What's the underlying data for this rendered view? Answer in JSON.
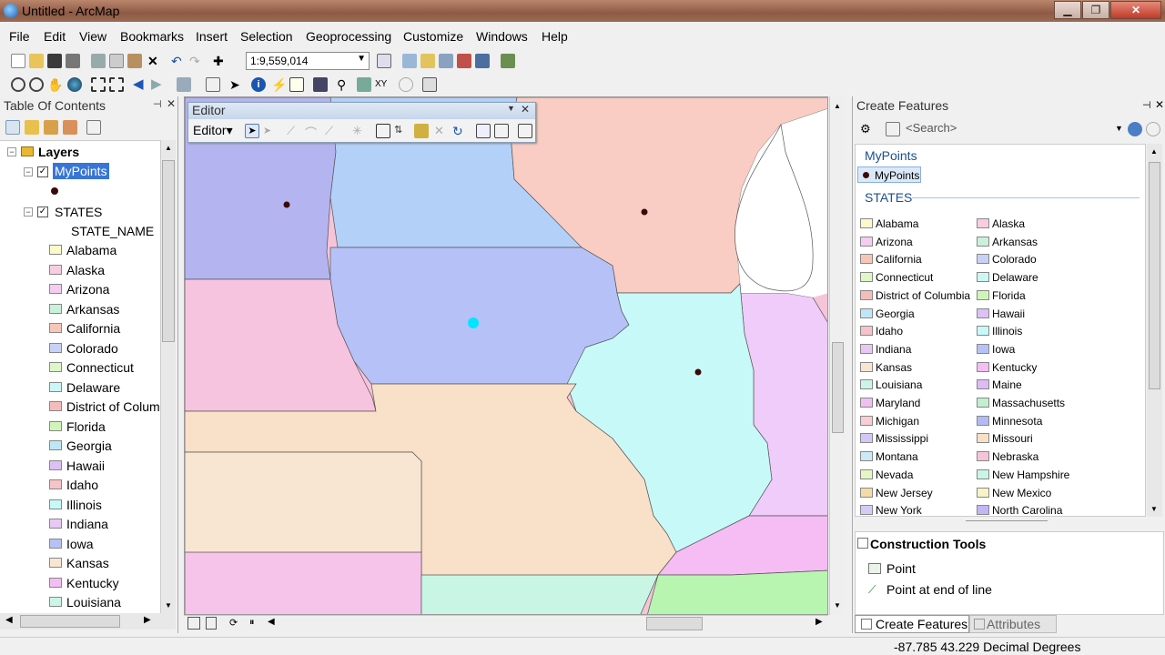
{
  "window": {
    "title": "Untitled - ArcMap",
    "minimize": "▁",
    "maximize": "❐",
    "close": "✕"
  },
  "menu": [
    "File",
    "Edit",
    "View",
    "Bookmarks",
    "Insert",
    "Selection",
    "Geoprocessing",
    "Customize",
    "Windows",
    "Help"
  ],
  "toolbar": {
    "scale": "1:9,559,014"
  },
  "toc": {
    "title": "Table Of Contents",
    "layers_label": "Layers",
    "mypoints": "MyPoints",
    "states": "STATES",
    "field": "STATE_NAME",
    "items": [
      {
        "name": "Alabama",
        "color": "#fbfacb"
      },
      {
        "name": "Alaska",
        "color": "#f8cde0"
      },
      {
        "name": "Arizona",
        "color": "#f6cdf0"
      },
      {
        "name": "Arkansas",
        "color": "#c9f1da"
      },
      {
        "name": "California",
        "color": "#f8c6b8"
      },
      {
        "name": "Colorado",
        "color": "#c8d2f6"
      },
      {
        "name": "Connecticut",
        "color": "#ddf7c8"
      },
      {
        "name": "Delaware",
        "color": "#cdf6f6"
      },
      {
        "name": "District of Colum",
        "color": "#f5bcbc"
      },
      {
        "name": "Florida",
        "color": "#d0f5b8"
      },
      {
        "name": "Georgia",
        "color": "#bde7f7"
      },
      {
        "name": "Hawaii",
        "color": "#dcc0f6"
      },
      {
        "name": "Idaho",
        "color": "#f6c3c8"
      },
      {
        "name": "Illinois",
        "color": "#c8f9f9"
      },
      {
        "name": "Indiana",
        "color": "#e8c8f4"
      },
      {
        "name": "Iowa",
        "color": "#b6c2f7"
      },
      {
        "name": "Kansas",
        "color": "#f9e6d2"
      },
      {
        "name": "Kentucky",
        "color": "#f5bdf3"
      },
      {
        "name": "Louisiana",
        "color": "#cbf5e6"
      }
    ]
  },
  "editor": {
    "title": "Editor",
    "menu": "Editor▾"
  },
  "create_features": {
    "title": "Create Features",
    "search_placeholder": "<Search>",
    "group_mypoints": "MyPoints",
    "mypoints_item": "MyPoints",
    "group_states": "STATES",
    "templates_left": [
      {
        "name": "Alabama",
        "color": "#fbfacb"
      },
      {
        "name": "Arizona",
        "color": "#f6cdf0"
      },
      {
        "name": "California",
        "color": "#f8c6b8"
      },
      {
        "name": "Connecticut",
        "color": "#ddf7c8"
      },
      {
        "name": "District of Columbia",
        "color": "#f5bcbc"
      },
      {
        "name": "Georgia",
        "color": "#bde7f7"
      },
      {
        "name": "Idaho",
        "color": "#f6c3c8"
      },
      {
        "name": "Indiana",
        "color": "#e8c8f4"
      },
      {
        "name": "Kansas",
        "color": "#f9e6d2"
      },
      {
        "name": "Louisiana",
        "color": "#cbf5e6"
      },
      {
        "name": "Maryland",
        "color": "#efc0f2"
      },
      {
        "name": "Michigan",
        "color": "#f8cdd4"
      },
      {
        "name": "Mississippi",
        "color": "#d4c6f6"
      },
      {
        "name": "Montana",
        "color": "#cbe9f7"
      },
      {
        "name": "Nevada",
        "color": "#e6f7c6"
      },
      {
        "name": "New Jersey",
        "color": "#f4dca8"
      },
      {
        "name": "New York",
        "color": "#d6cbf6"
      }
    ],
    "templates_right": [
      {
        "name": "Alaska",
        "color": "#f8cde0"
      },
      {
        "name": "Arkansas",
        "color": "#c9f1da"
      },
      {
        "name": "Colorado",
        "color": "#c8d2f6"
      },
      {
        "name": "Delaware",
        "color": "#cdf6f6"
      },
      {
        "name": "Florida",
        "color": "#d0f5b8"
      },
      {
        "name": "Hawaii",
        "color": "#dcc0f6"
      },
      {
        "name": "Illinois",
        "color": "#c8f9f9"
      },
      {
        "name": "Iowa",
        "color": "#b6c2f7"
      },
      {
        "name": "Kentucky",
        "color": "#f5bdf3"
      },
      {
        "name": "Maine",
        "color": "#dcbcf4"
      },
      {
        "name": "Massachusetts",
        "color": "#c2efd0"
      },
      {
        "name": "Minnesota",
        "color": "#b2bbf4"
      },
      {
        "name": "Missouri",
        "color": "#f8e0c6"
      },
      {
        "name": "Nebraska",
        "color": "#f6c4d8"
      },
      {
        "name": "New Hampshire",
        "color": "#c9f6e4"
      },
      {
        "name": "New Mexico",
        "color": "#f8f3c6"
      },
      {
        "name": "North Carolina",
        "color": "#c2b6f4"
      }
    ],
    "construction_title": "Construction Tools",
    "tools": [
      "Point",
      "Point at end of line"
    ],
    "tab_create": "Create Features",
    "tab_attributes": "Attributes"
  },
  "status": {
    "coords": "-87.785  43.229 Decimal Degrees"
  }
}
